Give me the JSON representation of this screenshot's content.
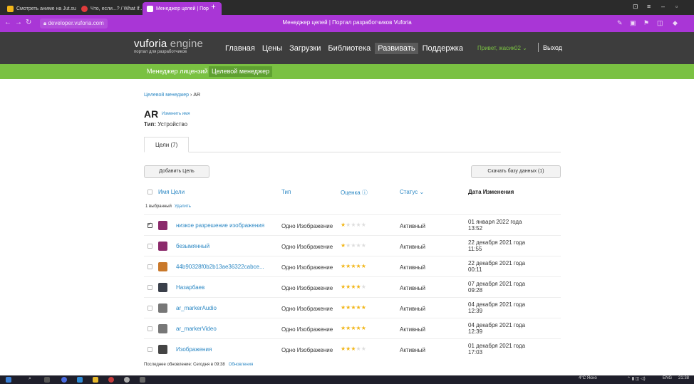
{
  "browser": {
    "tabs": [
      {
        "label": "Смотреть аниме на Jut.su",
        "favicon_color": "#f2b619"
      },
      {
        "label": "Что, если...? / What If...?",
        "favicon_color": "#e03c3c"
      },
      {
        "label": "Менеджер целей | Пор",
        "favicon_color": "#ffffff"
      }
    ],
    "tab_close": "×",
    "new_tab": "+",
    "url": "developer.vuforia.com",
    "page_title": "Менеджер целей | Портал разработчиков Vuforia",
    "accent_color": "#a936d6"
  },
  "site": {
    "logo_main": "vuforia",
    "logo_light": " engine",
    "logo_tag": "портал для разработчиков",
    "nav": [
      "Главная",
      "Цены",
      "Загрузки",
      "Библиотека",
      "Развивать",
      "Поддержка"
    ],
    "greeting": "Привет, жасик02 ⌄",
    "logout": "Выход",
    "subnav": [
      "Менеджер лицензий",
      "Целевой менеджер"
    ]
  },
  "page": {
    "breadcrumb_link": "Целевой менеджер",
    "breadcrumb_sep": " › ",
    "breadcrumb_current": "AR",
    "title": "AR",
    "rename": "Изменить имя",
    "type_label": "Тип:",
    "type_value": " Устройство",
    "tab_targets": "Цели (7)",
    "add_target": "Добавить Цель",
    "download_db": "Скачать базу данных (1)",
    "columns": {
      "name": "Имя Цели",
      "type": "Тип",
      "rating": "Оценка ⓘ",
      "status": "Статус ⌄",
      "modified": "Дата Изменения"
    },
    "selected_count": "1 выбранный",
    "delete": "Удалить",
    "footer_text": "Последнее обновление: Сегодня в 09:38",
    "footer_link": "Обновления"
  },
  "targets": [
    {
      "name": "низкое разрешение изображения",
      "type": "Одно Изображение",
      "rating": 1,
      "status": "Активный",
      "date": "01 января 2022 года 13:52",
      "checked": true,
      "thumb": "#8b2a6b"
    },
    {
      "name": "безымянный",
      "type": "Одно Изображение",
      "rating": 1,
      "status": "Активный",
      "date": "22 декабря 2021 года 11:55",
      "checked": false,
      "thumb": "#8b2a6b"
    },
    {
      "name": "44b90328f0b2b13ae36322cabce...",
      "type": "Одно Изображение",
      "rating": 5,
      "status": "Активный",
      "date": "22 декабря 2021 года 00:11",
      "checked": false,
      "thumb": "#c9782a"
    },
    {
      "name": "Назарбаев",
      "type": "Одно Изображение",
      "rating": 4,
      "status": "Активный",
      "date": "07 декабря 2021 года 09:28",
      "checked": false,
      "thumb": "#3a3f4a"
    },
    {
      "name": "ar_markerAudio",
      "type": "Одно Изображение",
      "rating": 5,
      "status": "Активный",
      "date": "04 декабря 2021 года 12:39",
      "checked": false,
      "thumb": "#777777"
    },
    {
      "name": "ar_markerVideo",
      "type": "Одно Изображение",
      "rating": 5,
      "status": "Активный",
      "date": "04 декабря 2021 года 12:39",
      "checked": false,
      "thumb": "#777777"
    },
    {
      "name": "Изображения",
      "type": "Одно Изображение",
      "rating": 3,
      "status": "Активный",
      "date": "01 декабря 2021 года 17:03",
      "checked": false,
      "thumb": "#444444"
    }
  ],
  "taskbar": {
    "weather": "4°C Ясно",
    "lang": "ENG",
    "time": "21:38"
  }
}
